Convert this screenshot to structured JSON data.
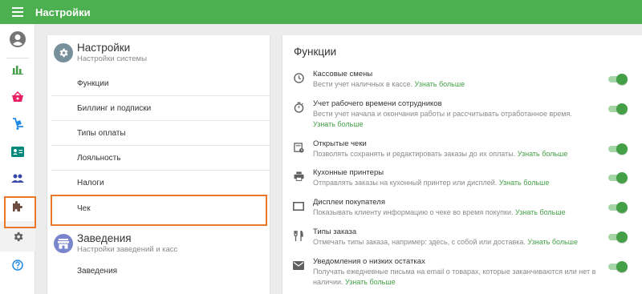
{
  "topbar": {
    "title": "Настройки",
    "menu_icon": "menu-icon"
  },
  "colors": {
    "accent": "#4caf50",
    "highlight": "#e8782a",
    "link": "#43a047"
  },
  "leftnav": {
    "items": [
      {
        "name": "account-icon"
      },
      {
        "name": "reports-icon"
      },
      {
        "name": "items-icon"
      },
      {
        "name": "inventory-icon"
      },
      {
        "name": "employees-icon"
      },
      {
        "name": "customers-icon"
      },
      {
        "name": "integrations-icon"
      },
      {
        "name": "settings-icon",
        "active": true
      },
      {
        "name": "help-icon"
      }
    ]
  },
  "settings_menu": {
    "system": {
      "title": "Настройки",
      "subtitle": "Настройки системы",
      "items": [
        "Функции",
        "Биллинг и подписки",
        "Типы оплаты",
        "Лояльность",
        "Налоги",
        "Чек"
      ]
    },
    "stores": {
      "title": "Заведения",
      "subtitle": "Настройки заведений и касс",
      "items": [
        "Заведения"
      ]
    }
  },
  "features": {
    "title": "Функции",
    "items": [
      {
        "icon": "clock-icon",
        "title": "Кассовые смены",
        "desc": "Вести учет наличных в кассе.",
        "link": "Узнать больше",
        "enabled": true
      },
      {
        "icon": "stopwatch-icon",
        "title": "Учет рабочего времени сотрудников",
        "desc": "Вести учет начала и окончания работы и рассчитывать отработанное время.",
        "link": "Узнать больше",
        "enabled": true
      },
      {
        "icon": "open-tickets-icon",
        "title": "Открытые чеки",
        "desc": "Позволять сохранять и редактировать заказы до их оплаты.",
        "link": "Узнать больше",
        "enabled": true
      },
      {
        "icon": "printer-icon",
        "title": "Кухонные принтеры",
        "desc": "Отправлять заказы на кухонный принтер или дисплей.",
        "link": "Узнать больше",
        "enabled": true
      },
      {
        "icon": "display-icon",
        "title": "Дисплеи покупателя",
        "desc": "Показывать клиенту информацию о чеке во время покупки.",
        "link": "Узнать больше",
        "enabled": true
      },
      {
        "icon": "dining-icon",
        "title": "Типы заказа",
        "desc": "Отмечать типы заказа, например: здесь, с собой или доставка.",
        "link": "Узнать больше",
        "enabled": true
      },
      {
        "icon": "mail-icon",
        "title": "Уведомления о низких остатках",
        "desc": "Получать ежедневные письма на email о товарах, которые заканчиваются или нет в наличии.",
        "link": "Узнать больше",
        "enabled": true
      }
    ]
  }
}
